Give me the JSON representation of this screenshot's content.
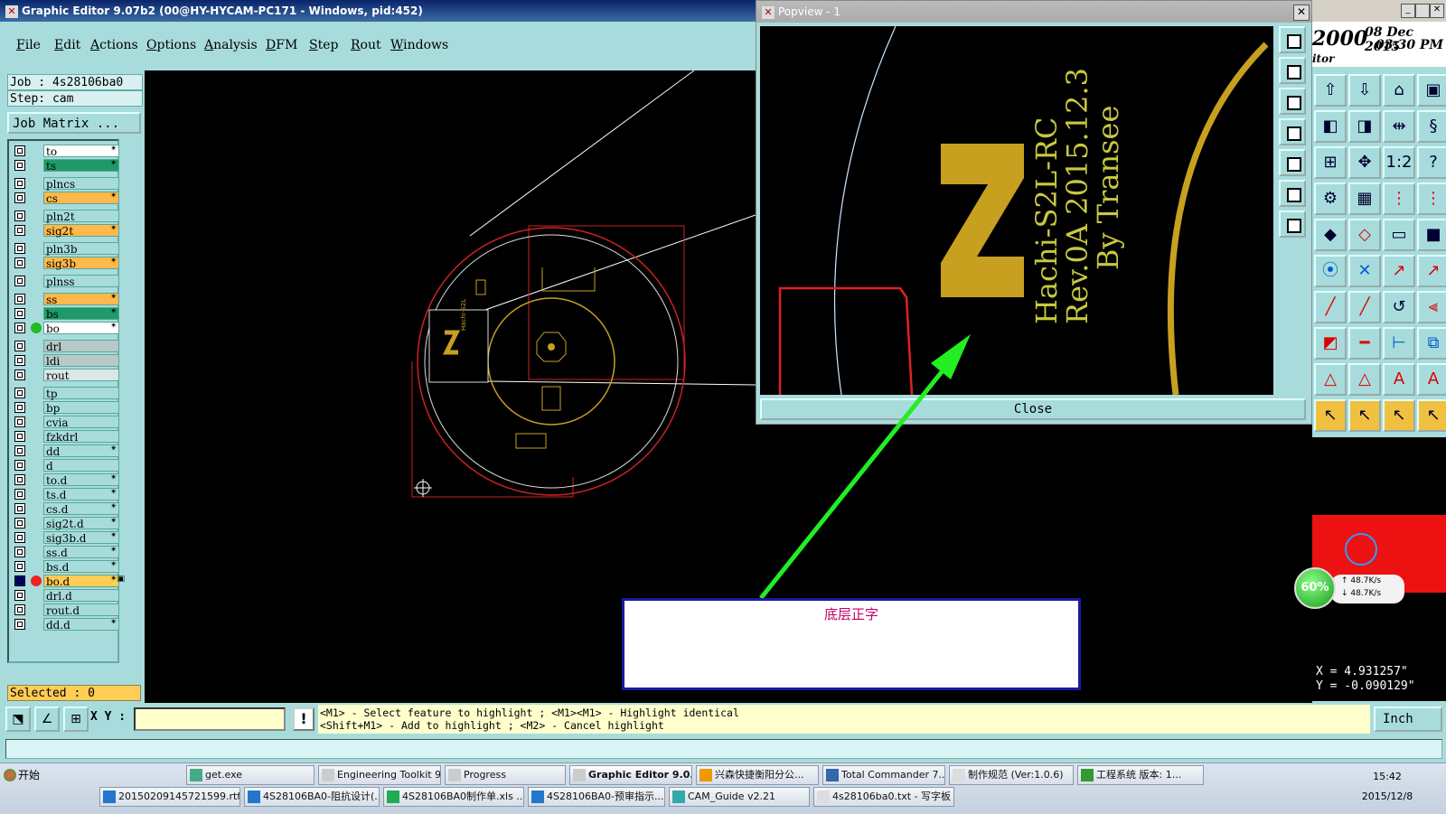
{
  "main_window": {
    "title": "Graphic Editor 9.07b2 (00@HY-HYCAM-PC171 - Windows, pid:452)",
    "menu": [
      "File",
      "Edit",
      "Actions",
      "Options",
      "Analysis",
      "DFM",
      "Step",
      "Rout",
      "Windows"
    ]
  },
  "job_panel": {
    "job": "Job : 4s28106ba0",
    "step": "Step: cam",
    "matrix_button": "Job Matrix ...",
    "selected": "Selected : 0"
  },
  "layers": [
    {
      "name": "to",
      "color": "#ffffff",
      "mark": "✴"
    },
    {
      "name": "ts",
      "color": "#1e9a6a",
      "mark": "✴"
    },
    {
      "name": "plncs",
      "color": "#a8dcdc",
      "mark": ""
    },
    {
      "name": "cs",
      "color": "#ffb84a",
      "mark": "✴"
    },
    {
      "name": "pln2t",
      "color": "#a8dcdc",
      "mark": ""
    },
    {
      "name": "sig2t",
      "color": "#ffb84a",
      "mark": "✴"
    },
    {
      "name": "pln3b",
      "color": "#a8dcdc",
      "mark": ""
    },
    {
      "name": "sig3b",
      "color": "#ffb84a",
      "mark": "✴"
    },
    {
      "name": "plnss",
      "color": "#a8dcdc",
      "mark": ""
    },
    {
      "name": "ss",
      "color": "#ffb84a",
      "mark": "✴"
    },
    {
      "name": "bs",
      "color": "#1e9a6a",
      "mark": "✴"
    },
    {
      "name": "bo",
      "color": "#ffffff",
      "mark": "✴",
      "dot": "#22bb22"
    },
    {
      "name": "drl",
      "color": "#b8c8c8",
      "mark": ""
    },
    {
      "name": "ldi",
      "color": "#b8c8c8",
      "mark": ""
    },
    {
      "name": "rout",
      "color": "#dde6e6",
      "mark": ""
    },
    {
      "name": "tp",
      "color": "#a8dcdc",
      "mark": ""
    },
    {
      "name": "bp",
      "color": "#a8dcdc",
      "mark": ""
    },
    {
      "name": "cvia",
      "color": "#a8dcdc",
      "mark": ""
    },
    {
      "name": "fzkdrl",
      "color": "#a8dcdc",
      "mark": ""
    },
    {
      "name": "dd",
      "color": "#a8dcdc",
      "mark": "✴"
    },
    {
      "name": "d",
      "color": "#a8dcdc",
      "mark": ""
    },
    {
      "name": "to.d",
      "color": "#a8dcdc",
      "mark": "✴"
    },
    {
      "name": "ts.d",
      "color": "#a8dcdc",
      "mark": "✴"
    },
    {
      "name": "cs.d",
      "color": "#a8dcdc",
      "mark": "✴"
    },
    {
      "name": "sig2t.d",
      "color": "#a8dcdc",
      "mark": "✴"
    },
    {
      "name": "sig3b.d",
      "color": "#a8dcdc",
      "mark": "✴"
    },
    {
      "name": "ss.d",
      "color": "#a8dcdc",
      "mark": "✴"
    },
    {
      "name": "bs.d",
      "color": "#a8dcdc",
      "mark": "✴"
    },
    {
      "name": "bo.d",
      "color": "#ffcc55",
      "mark": "✴▣",
      "dot": "#ee2222",
      "checked": true
    },
    {
      "name": "drl.d",
      "color": "#a8dcdc",
      "mark": ""
    },
    {
      "name": "rout.d",
      "color": "#a8dcdc",
      "mark": ""
    },
    {
      "name": "dd.d",
      "color": "#a8dcdc",
      "mark": "✴"
    }
  ],
  "popview": {
    "title": "Popview - 1",
    "close_label": "Close",
    "board_text": [
      "Hachi-S2L-RC",
      "Rev.0A 2015.12.3",
      "By Transee"
    ]
  },
  "right_panel": {
    "header_left": "2000",
    "date": "08 Dec 2015",
    "time": "03:30 PM",
    "sub_label": "itor",
    "coords": {
      "x": "X = 4.931257\"",
      "y": "Y = -0.090129\""
    }
  },
  "net_widget": {
    "percent": "60%",
    "up": "48.7K/s",
    "down": "48.7K/s"
  },
  "command_bar": {
    "xy_label": "X Y :",
    "xy_value": "",
    "hint_line1": "<M1> - Select feature to highlight ; <M1><M1> - Highlight identical",
    "hint_line2": "<Shift+M1> - Add to highlight ; <M2> - Cancel highlight",
    "unit": "Inch"
  },
  "annotation": {
    "text": "底层正字"
  },
  "taskbar": {
    "start_label": "开始",
    "row1": [
      "get.exe",
      "Engineering Toolkit 9...",
      "Progress",
      "Graphic Editor 9.0...",
      "兴森快捷衡阳分公...",
      "Total Commander 7....",
      "制作规范 (Ver:1.0.6)",
      "工程系统  版本: 1..."
    ],
    "row2": [
      "20150209145721599.rtf...",
      "4S28106BA0-阻抗设计(...",
      "4S28106BA0制作单.xls ...",
      "4S28106BA0-预审指示...",
      "CAM_Guide v2.21",
      "4s28106ba0.txt - 写字板"
    ],
    "time": "15:42",
    "date": "2015/12/8"
  },
  "colors": {
    "panel": "#a8dcdc",
    "accent_red": "#ee1111",
    "gold": "#c8a020",
    "arrow": "#22ee22"
  }
}
